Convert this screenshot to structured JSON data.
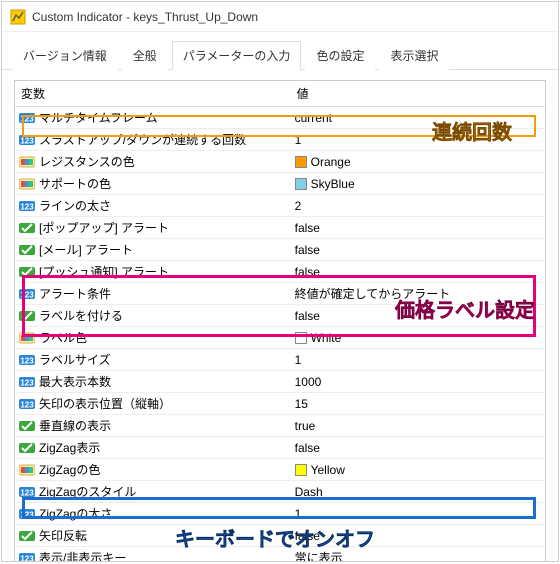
{
  "window": {
    "title": "Custom Indicator - keys_Thrust_Up_Down"
  },
  "tabs": {
    "items": [
      {
        "label": "バージョン情報"
      },
      {
        "label": "全般"
      },
      {
        "label": "パラメーターの入力"
      },
      {
        "label": "色の設定"
      },
      {
        "label": "表示選択"
      }
    ],
    "active_index": 2
  },
  "table": {
    "headers": {
      "variable": "変数",
      "value": "値"
    },
    "rows": [
      {
        "icon": "int",
        "name": "マルチタイムフレーム",
        "value": "current"
      },
      {
        "icon": "int",
        "name": "スラストアップ/ダウンが連続する回数",
        "value": "1"
      },
      {
        "icon": "color",
        "name": "レジスタンスの色",
        "value": "Orange",
        "swatch": "#ff9900"
      },
      {
        "icon": "color",
        "name": "サポートの色",
        "value": "SkyBlue",
        "swatch": "#87ceeb"
      },
      {
        "icon": "int",
        "name": "ラインの太さ",
        "value": "2"
      },
      {
        "icon": "bool",
        "name": "[ポップアップ] アラート",
        "value": "false"
      },
      {
        "icon": "bool",
        "name": "[メール] アラート",
        "value": "false"
      },
      {
        "icon": "bool",
        "name": "[プッシュ通知] アラート",
        "value": "false"
      },
      {
        "icon": "int",
        "name": "アラート条件",
        "value": "終値が確定してからアラート"
      },
      {
        "icon": "bool",
        "name": "ラベルを付ける",
        "value": "false"
      },
      {
        "icon": "color",
        "name": "ラベル色",
        "value": "White",
        "swatch": "#ffffff"
      },
      {
        "icon": "int",
        "name": "ラベルサイズ",
        "value": "1"
      },
      {
        "icon": "int",
        "name": "最大表示本数",
        "value": "1000"
      },
      {
        "icon": "int",
        "name": "矢印の表示位置（縦軸）",
        "value": "15"
      },
      {
        "icon": "bool",
        "name": "垂直線の表示",
        "value": "true"
      },
      {
        "icon": "bool",
        "name": "ZigZag表示",
        "value": "false"
      },
      {
        "icon": "color",
        "name": "ZigZagの色",
        "value": "Yellow",
        "swatch": "#ffff00"
      },
      {
        "icon": "int",
        "name": "ZigZagのスタイル",
        "value": "Dash"
      },
      {
        "icon": "int",
        "name": "ZigZagの太さ",
        "value": "1"
      },
      {
        "icon": "bool",
        "name": "矢印反転",
        "value": "false"
      },
      {
        "icon": "int",
        "name": "表示/非表示キー",
        "value": "常に表示"
      }
    ]
  },
  "annotations": {
    "orange_label": "連続回数",
    "pink_label": "価格ラベル設定",
    "blue_label": "キーボードでオンオフ"
  }
}
